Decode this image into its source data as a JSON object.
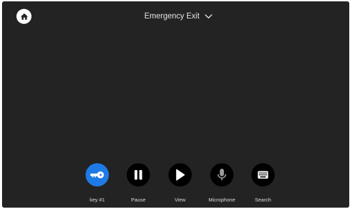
{
  "header": {
    "title": "Emergency Exit",
    "home_icon": "home-icon",
    "dropdown_icon": "chevron-down-icon"
  },
  "controls": [
    {
      "label": "key #1",
      "icon": "key-icon",
      "active": true
    },
    {
      "label": "Pause",
      "icon": "pause-icon",
      "active": false
    },
    {
      "label": "View",
      "icon": "play-icon",
      "active": false
    },
    {
      "label": "Microphone",
      "icon": "microphone-icon",
      "active": false
    },
    {
      "label": "Search",
      "icon": "keyboard-icon",
      "active": false
    }
  ],
  "colors": {
    "background": "#232323",
    "primary": "#1e7be6",
    "button": "#000000",
    "text": "#e6e6e6"
  }
}
